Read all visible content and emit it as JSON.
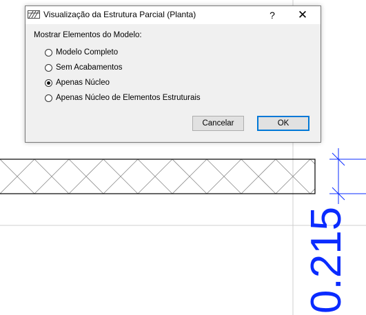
{
  "dialog": {
    "title": "Visualização da Estrutura Parcial (Planta)",
    "help_label": "?",
    "close_label": "✕",
    "group_label": "Mostrar Elementos do Modelo:",
    "options": [
      {
        "label": "Modelo Completo",
        "checked": false
      },
      {
        "label": "Sem Acabamentos",
        "checked": false
      },
      {
        "label": "Apenas Núcleo",
        "checked": true
      },
      {
        "label": "Apenas Núcleo de Elementos Estruturais",
        "checked": false
      }
    ],
    "cancel_label": "Cancelar",
    "ok_label": "OK"
  },
  "drawing": {
    "dimension_text": "0.215",
    "dimension_color": "#0a2bff",
    "wall_hatch_color": "#8c8c8c"
  }
}
